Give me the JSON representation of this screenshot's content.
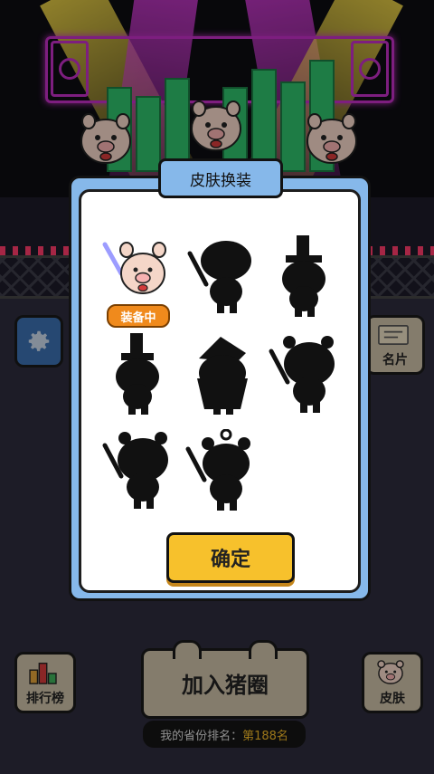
{
  "modal": {
    "title": "皮肤换装",
    "equipped_badge": "装备中",
    "confirm_label": "确定",
    "skins": [
      {
        "state": "unlocked",
        "equipped": true
      },
      {
        "state": "locked"
      },
      {
        "state": "locked"
      },
      {
        "state": "locked"
      },
      {
        "state": "locked"
      },
      {
        "state": "locked"
      },
      {
        "state": "locked"
      },
      {
        "state": "locked"
      }
    ]
  },
  "buttons": {
    "card_label": "名片",
    "rank_label": "排行榜",
    "skin_label": "皮肤",
    "join_label": "加入猪圈"
  },
  "rank": {
    "prefix": "我的省份排名：",
    "value": "第188名"
  },
  "colors": {
    "modal_frame": "#86b8ea",
    "confirm_button": "#f7c12c",
    "equipped_badge": "#f08a1c",
    "rank_highlight": "#f1b828"
  }
}
